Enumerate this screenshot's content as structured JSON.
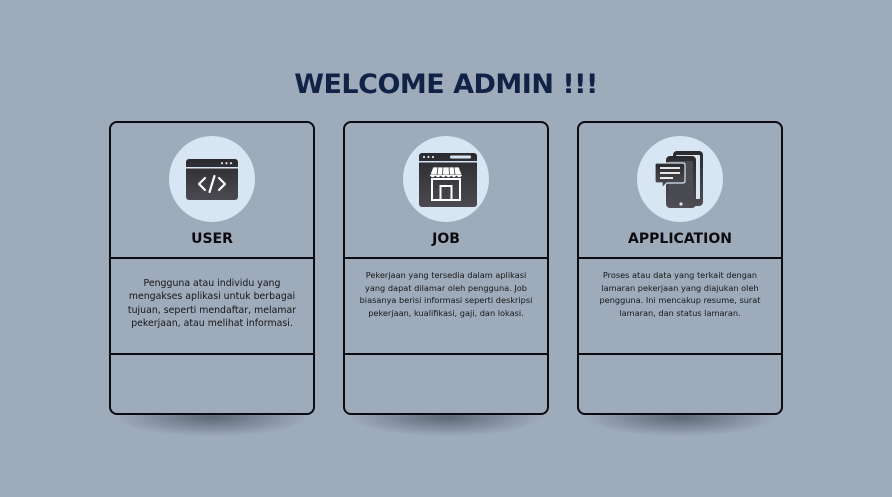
{
  "page": {
    "title": "WELCOME ADMIN !!!"
  },
  "cards": [
    {
      "title": "USER",
      "icon": "code-window-icon",
      "description": "Pengguna atau individu yang mengakses aplikasi untuk berbagai tujuan, seperti mendaftar, melamar pekerjaan, atau melihat informasi."
    },
    {
      "title": "JOB",
      "icon": "store-window-icon",
      "description": "Pekerjaan yang tersedia dalam aplikasi yang dapat dilamar oleh pengguna. Job biasanya berisi informasi seperti deskripsi pekerjaan, kualifikasi, gaji, dan lokasi."
    },
    {
      "title": "APPLICATION",
      "icon": "mobile-documents-icon",
      "description": "Proses atau data yang terkait dengan lamaran pekerjaan yang diajukan oleh pengguna. Ini mencakup resume, surat lamaran, dan status lamaran."
    }
  ],
  "colors": {
    "background": "#9eabbb",
    "title": "#102347",
    "icon_circle": "#d8e6f3",
    "border": "#0c0c10"
  }
}
